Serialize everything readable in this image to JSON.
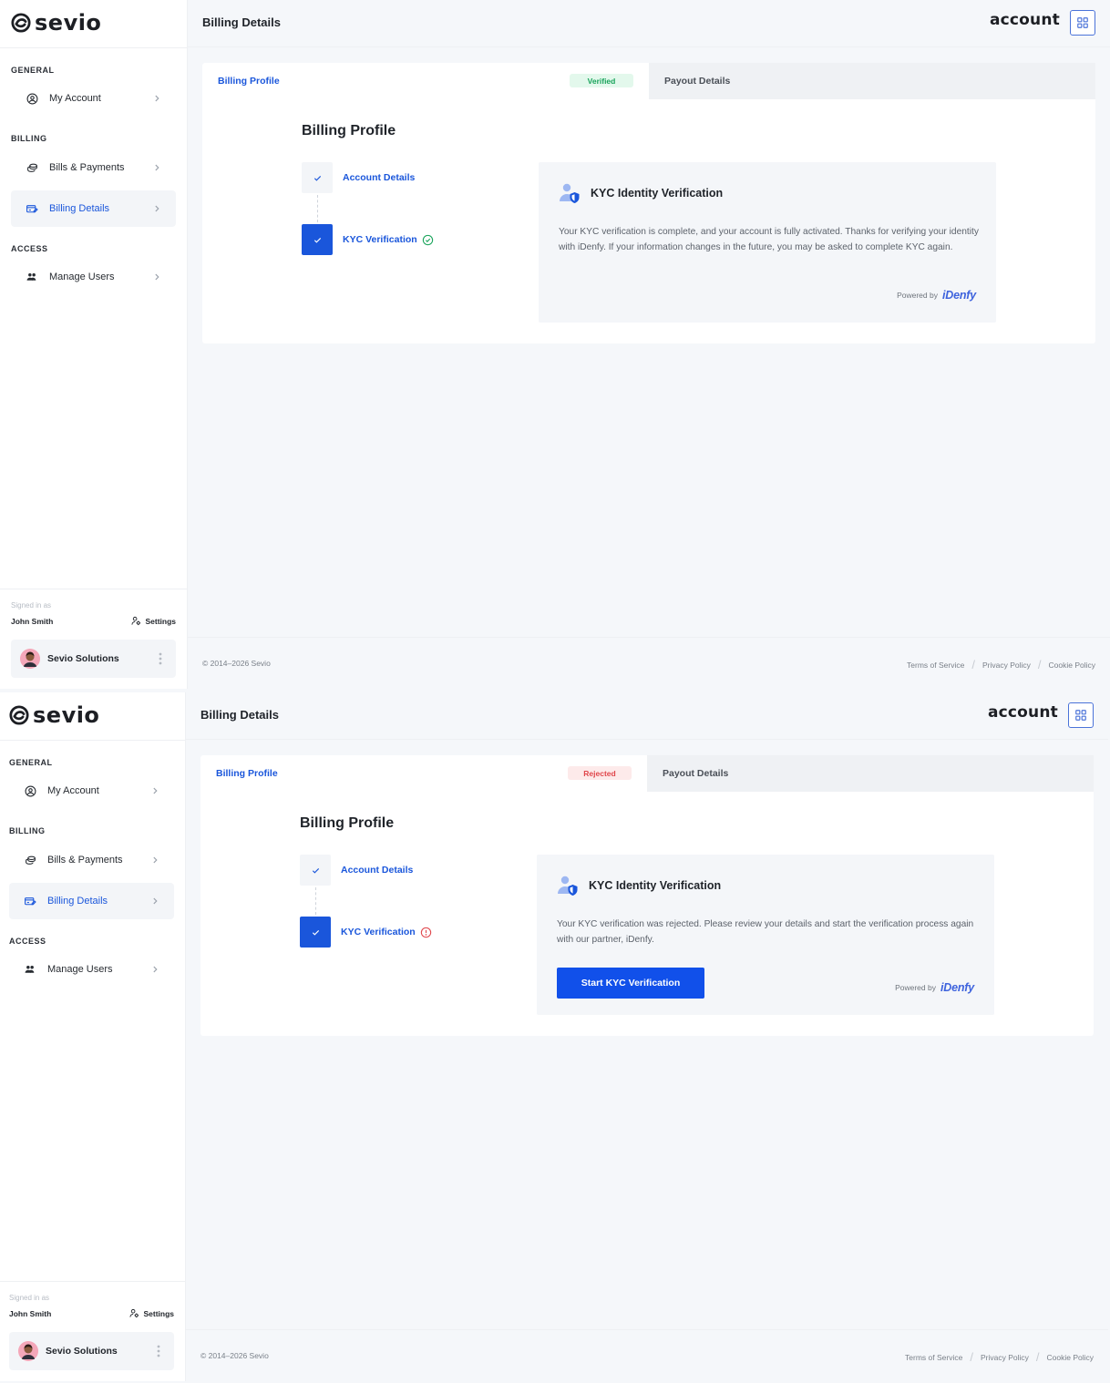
{
  "app": {
    "logo_text": "sevio",
    "header_title": "Billing Details",
    "header_brand": "account",
    "sections": {
      "general": "GENERAL",
      "billing": "BILLING",
      "access": "ACCESS"
    },
    "nav": {
      "my_account": "My Account",
      "bills_payments": "Bills & Payments",
      "billing_details": "Billing Details",
      "manage_users": "Manage Users"
    },
    "user": {
      "signed_in_label": "Signed in as",
      "name": "John Smith",
      "settings_label": "Settings",
      "org_name": "Sevio Solutions"
    },
    "footer": {
      "copyright": "© 2014–2026 Sevio",
      "terms": "Terms of Service",
      "privacy": "Privacy Policy",
      "cookie": "Cookie Policy",
      "separator": "/"
    },
    "tabs": {
      "billing_profile": "Billing Profile",
      "payout_details": "Payout Details"
    },
    "profile_title": "Billing Profile",
    "steps": {
      "account_details": "Account Details",
      "kyc_verification": "KYC Verification"
    },
    "kyc_title": "KYC Identity Verification",
    "powered_label": "Powered by",
    "powered_brand": "iDenfy"
  },
  "screens": [
    {
      "status_badge": "Verified",
      "kyc_description": "Your KYC verification is complete, and your account is fully activated. Thanks for verifying your identity with iDenfy. If your information changes in the future, you may be asked to complete KYC again."
    },
    {
      "status_badge": "Rejected",
      "kyc_description": "Your KYC verification was rejected. Please review your details and start the verification process again with our partner, iDenfy.",
      "kyc_button": "Start KYC Verification"
    }
  ],
  "colors": {
    "accent": "#1a56db",
    "button": "#1150ea",
    "verified": "#18a35a",
    "rejected": "#e0464b"
  },
  "icons": {
    "logo": "sevio-logo-icon",
    "my_account": "user-circle-icon",
    "bills": "coins-icon",
    "billing_details": "card-edit-icon",
    "manage_users": "users-icon",
    "chevron": "chevron-right-icon",
    "settings": "user-cog-icon",
    "more": "dots-vertical-icon",
    "apps": "grid-icon",
    "check": "check-icon",
    "verified": "check-circle-icon",
    "rejected": "alert-circle-icon",
    "kyc": "user-shield-icon"
  }
}
